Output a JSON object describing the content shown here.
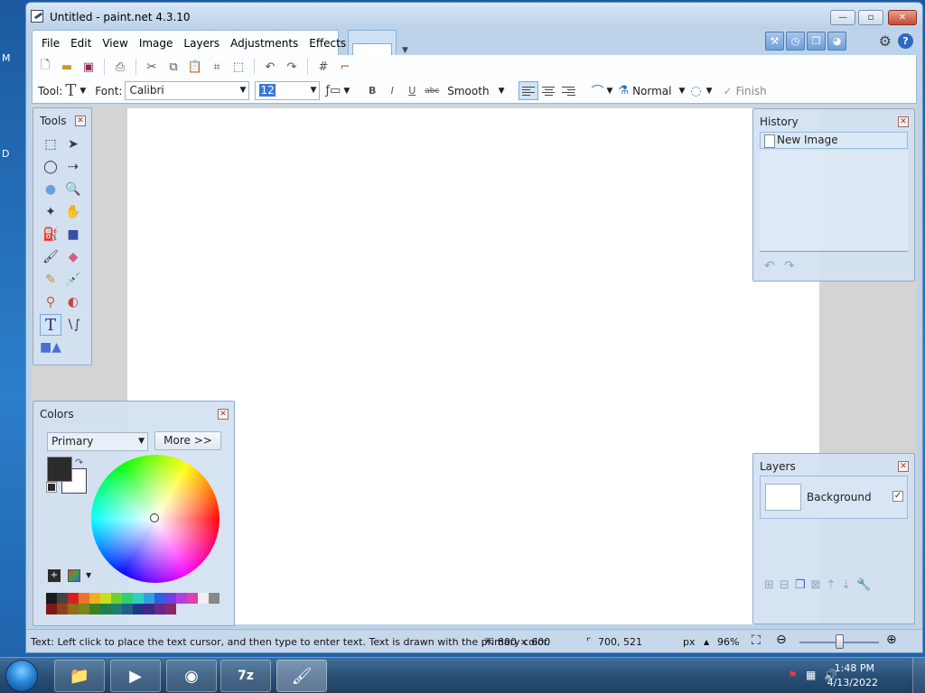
{
  "desktop": {
    "letters": [
      "M",
      "D"
    ]
  },
  "window": {
    "title": "Untitled - paint.net 4.3.10",
    "minimize": "—",
    "maximize": "▫",
    "close": "✕"
  },
  "menu": {
    "items": [
      "File",
      "Edit",
      "View",
      "Image",
      "Layers",
      "Adjustments",
      "Effects"
    ]
  },
  "toolbar2": {
    "tool_label": "Tool:",
    "font_label": "Font:",
    "font_value": "Calibri",
    "size_value": "12",
    "bold": "B",
    "italic": "I",
    "underline": "U",
    "strike": "abc",
    "antialias": "Smooth",
    "blend": "Normal",
    "finish": "Finish"
  },
  "tools_panel": {
    "title": "Tools"
  },
  "colors_panel": {
    "title": "Colors",
    "mode": "Primary",
    "more_button": "More >>",
    "primary_color": "#2b2b2b",
    "secondary_color": "#ffffff",
    "palette": [
      "#1a1a1a",
      "#444444",
      "#d42020",
      "#f07030",
      "#f0b020",
      "#c8e020",
      "#70d030",
      "#30d070",
      "#30d0c0",
      "#30a0e0",
      "#3060e0",
      "#7040e0",
      "#b040e0",
      "#e040b0",
      "#f0f0f0",
      "#888888",
      "#801818",
      "#904020",
      "#907018",
      "#788818",
      "#408020",
      "#208048",
      "#208070",
      "#206088",
      "#203888",
      "#402888",
      "#682888",
      "#882868"
    ]
  },
  "history_panel": {
    "title": "History",
    "items": [
      "New Image"
    ]
  },
  "layers_panel": {
    "title": "Layers",
    "items": [
      {
        "name": "Background",
        "visible": true
      }
    ]
  },
  "statusbar": {
    "hint": "Text: Left click to place the text cursor, and then type to enter text. Text is drawn with the primary color.",
    "image_size": "800 × 600",
    "cursor_pos": "700, 521",
    "units": "px",
    "zoom": "96%"
  },
  "taskbar": {
    "apps": [
      "explorer",
      "media-player",
      "chrome",
      "7-zip",
      "paint.net"
    ],
    "time": "1:48 PM",
    "date": "4/13/2022"
  }
}
